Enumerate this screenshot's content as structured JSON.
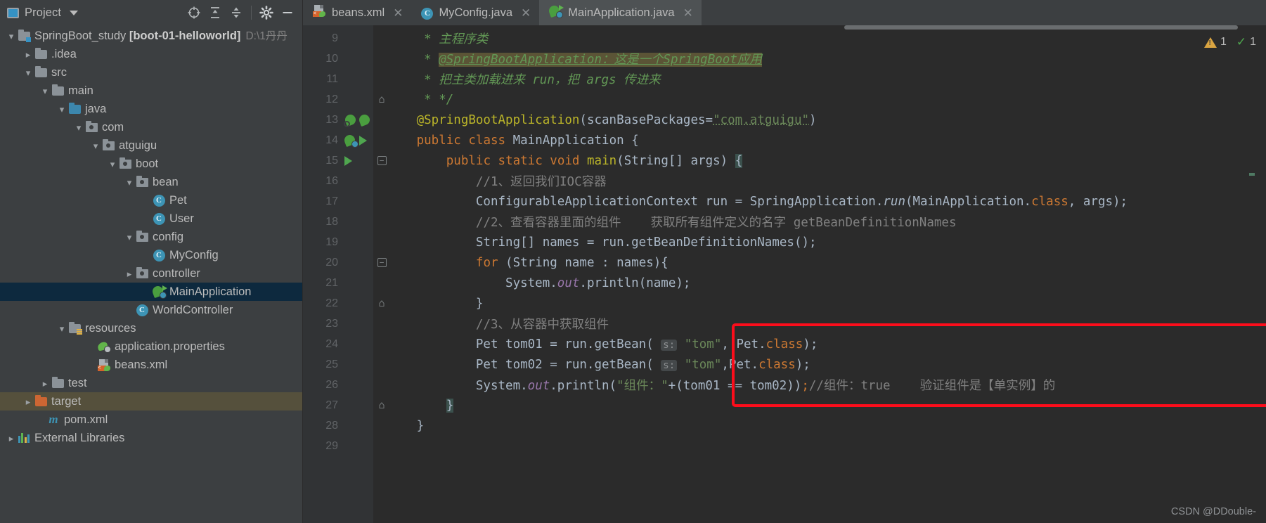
{
  "project_panel": {
    "title": "Project",
    "toolbar_icons": [
      "locate-icon",
      "expand-all-icon",
      "collapse-all-icon",
      "settings-gear-icon",
      "minimize-icon"
    ],
    "tree": [
      {
        "label": "SpringBoot_study",
        "bold_label": "[boot-01-helloworld]",
        "suffix": "D:\\1丹丹",
        "indent": 0,
        "arrow": "down",
        "icon": "module-folder-icon"
      },
      {
        "label": ".idea",
        "indent": 1,
        "arrow": "right",
        "icon": "folder-icon"
      },
      {
        "label": "src",
        "indent": 1,
        "arrow": "down",
        "icon": "folder-icon"
      },
      {
        "label": "main",
        "indent": 2,
        "arrow": "down",
        "icon": "folder-icon"
      },
      {
        "label": "java",
        "indent": 3,
        "arrow": "down",
        "icon": "source-folder-icon"
      },
      {
        "label": "com",
        "indent": 4,
        "arrow": "down",
        "icon": "package-icon"
      },
      {
        "label": "atguigu",
        "indent": 5,
        "arrow": "down",
        "icon": "package-icon"
      },
      {
        "label": "boot",
        "indent": 6,
        "arrow": "down",
        "icon": "package-icon"
      },
      {
        "label": "bean",
        "indent": 7,
        "arrow": "down",
        "icon": "package-icon"
      },
      {
        "label": "Pet",
        "indent": 8,
        "arrow": "none",
        "icon": "class-icon"
      },
      {
        "label": "User",
        "indent": 8,
        "arrow": "none",
        "icon": "class-icon"
      },
      {
        "label": "config",
        "indent": 7,
        "arrow": "down",
        "icon": "package-icon"
      },
      {
        "label": "MyConfig",
        "indent": 8,
        "arrow": "none",
        "icon": "class-icon"
      },
      {
        "label": "controller",
        "indent": 7,
        "arrow": "right",
        "icon": "package-icon"
      },
      {
        "label": "MainApplication",
        "indent": 8,
        "arrow": "none",
        "icon": "spring-class-icon",
        "selected": true
      },
      {
        "label": "WorldController",
        "indent": 8,
        "arrow": "none",
        "icon": "class-icon"
      },
      {
        "label": "resources",
        "indent": 3,
        "arrow": "down",
        "icon": "resources-folder-icon"
      },
      {
        "label": "application.properties",
        "indent": 4,
        "arrow": "none",
        "icon": "spring-properties-icon"
      },
      {
        "label": "beans.xml",
        "indent": 4,
        "arrow": "none",
        "icon": "spring-xml-icon"
      },
      {
        "label": "test",
        "indent": 2,
        "arrow": "right",
        "icon": "folder-icon"
      },
      {
        "label": "target",
        "indent": 1,
        "arrow": "right",
        "icon": "excluded-folder-icon",
        "highlight": true
      },
      {
        "label": "pom.xml",
        "indent": 1,
        "arrow": "none",
        "icon": "maven-icon"
      },
      {
        "label": "External Libraries",
        "indent": 0,
        "arrow": "right",
        "icon": "libraries-icon"
      }
    ]
  },
  "tabs": [
    {
      "label": "beans.xml",
      "icon": "spring-xml-icon",
      "active": false,
      "closable": true
    },
    {
      "label": "MyConfig.java",
      "icon": "class-icon",
      "active": false,
      "closable": true
    },
    {
      "label": "MainApplication.java",
      "icon": "spring-class-icon",
      "active": true,
      "closable": true
    }
  ],
  "inspections": {
    "warning_count": "1",
    "spelling_count": "1"
  },
  "watermark": "CSDN @DDouble-",
  "editor": {
    "first_visible_line": 9,
    "lines": [
      {
        "no": "9",
        "segments": [
          {
            "t": "    * ",
            "c": "c-jdoc"
          },
          {
            "t": "主程序类",
            "c": "c-jdoc"
          }
        ]
      },
      {
        "no": "10",
        "segments": [
          {
            "t": "    * ",
            "c": "c-jdoc"
          },
          {
            "t": "@SpringBootApplication：这是一个SpringBoot应用",
            "c": "c-jdoc-link",
            "hl": true
          }
        ]
      },
      {
        "no": "11",
        "segments": [
          {
            "t": "    * ",
            "c": "c-jdoc"
          },
          {
            "t": "把主类加载进来 run，把 args 传进来",
            "c": "c-jdoc"
          }
        ]
      },
      {
        "no": "12",
        "segments": [
          {
            "t": "    * */",
            "c": "c-jdoc"
          }
        ],
        "fold": "end"
      },
      {
        "no": "13",
        "segments": [
          {
            "t": "   ",
            "c": "c-txt"
          },
          {
            "t": "@SpringBootApplication",
            "c": "c-ann"
          },
          {
            "t": "(scanBasePackages=",
            "c": "c-txt"
          },
          {
            "t": "\"com.atguigu\"",
            "c": "c-str",
            "underline": true
          },
          {
            "t": ")",
            "c": "c-txt"
          }
        ],
        "gutter": [
          "bean-icon",
          "check-icon"
        ]
      },
      {
        "no": "14",
        "segments": [
          {
            "t": "   ",
            "c": "c-txt"
          },
          {
            "t": "public",
            "c": "c-kw"
          },
          {
            "t": " ",
            "c": "c-txt"
          },
          {
            "t": "class",
            "c": "c-kw"
          },
          {
            "t": " MainApplication {",
            "c": "c-txt"
          }
        ],
        "gutter": [
          "spring-bean-icon",
          "run-icon"
        ]
      },
      {
        "no": "15",
        "segments": [
          {
            "t": "       ",
            "c": "c-txt"
          },
          {
            "t": "public",
            "c": "c-kw"
          },
          {
            "t": " ",
            "c": "c-txt"
          },
          {
            "t": "static",
            "c": "c-kw"
          },
          {
            "t": " ",
            "c": "c-txt"
          },
          {
            "t": "void",
            "c": "c-kw"
          },
          {
            "t": " ",
            "c": "c-txt"
          },
          {
            "t": "main",
            "c": "c-ann"
          },
          {
            "t": "(String[] args) ",
            "c": "c-txt"
          },
          {
            "t": "{",
            "c": "c-brace-hl"
          }
        ],
        "gutter": [
          "run-icon"
        ],
        "fold": "start"
      },
      {
        "no": "16",
        "segments": [
          {
            "t": "           ",
            "c": "c-txt"
          },
          {
            "t": "//1、返回我们IOC容器",
            "c": "c-cmt"
          }
        ]
      },
      {
        "no": "17",
        "segments": [
          {
            "t": "           ConfigurableApplicationContext run = SpringApplication.",
            "c": "c-txt"
          },
          {
            "t": "run",
            "c": "c-method"
          },
          {
            "t": "(MainApplication.",
            "c": "c-txt"
          },
          {
            "t": "class",
            "c": "c-kw"
          },
          {
            "t": ", args);",
            "c": "c-txt"
          }
        ]
      },
      {
        "no": "18",
        "segments": [
          {
            "t": "           ",
            "c": "c-txt"
          },
          {
            "t": "//2、查看容器里面的组件    获取所有组件定义的名字 getBeanDefinitionNames",
            "c": "c-cmt"
          }
        ]
      },
      {
        "no": "19",
        "segments": [
          {
            "t": "           String[] names = run.getBeanDefinitionNames();",
            "c": "c-txt"
          }
        ]
      },
      {
        "no": "20",
        "segments": [
          {
            "t": "           ",
            "c": "c-txt"
          },
          {
            "t": "for",
            "c": "c-kw"
          },
          {
            "t": " (String name : names){",
            "c": "c-txt"
          }
        ],
        "fold": "start"
      },
      {
        "no": "21",
        "segments": [
          {
            "t": "               System.",
            "c": "c-txt"
          },
          {
            "t": "out",
            "c": "c-static"
          },
          {
            "t": ".println(name);",
            "c": "c-txt"
          }
        ]
      },
      {
        "no": "22",
        "segments": [
          {
            "t": "           }",
            "c": "c-txt"
          }
        ],
        "fold": "end"
      },
      {
        "no": "23",
        "segments": [
          {
            "t": "           ",
            "c": "c-txt"
          },
          {
            "t": "//3、从容器中获取组件",
            "c": "c-cmt"
          }
        ]
      },
      {
        "no": "24",
        "segments": [
          {
            "t": "           Pet tom01 = run.getBean( ",
            "c": "c-txt"
          },
          {
            "t": "s:",
            "c": "hint"
          },
          {
            "t": " ",
            "c": "c-txt"
          },
          {
            "t": "\"tom\"",
            "c": "c-str"
          },
          {
            "t": ", Pet.",
            "c": "c-txt"
          },
          {
            "t": "class",
            "c": "c-kw"
          },
          {
            "t": ");",
            "c": "c-txt"
          }
        ]
      },
      {
        "no": "25",
        "segments": [
          {
            "t": "           Pet tom02 = run.getBean( ",
            "c": "c-txt"
          },
          {
            "t": "s:",
            "c": "hint"
          },
          {
            "t": " ",
            "c": "c-txt"
          },
          {
            "t": "\"tom\"",
            "c": "c-str"
          },
          {
            "t": ",Pet.",
            "c": "c-txt"
          },
          {
            "t": "class",
            "c": "c-kw"
          },
          {
            "t": ");",
            "c": "c-txt"
          }
        ]
      },
      {
        "no": "26",
        "segments": [
          {
            "t": "           System.",
            "c": "c-txt"
          },
          {
            "t": "out",
            "c": "c-static"
          },
          {
            "t": ".println(",
            "c": "c-txt"
          },
          {
            "t": "\"组件：\"",
            "c": "c-str"
          },
          {
            "t": "+(tom01 == tom02))",
            "c": "c-txt"
          },
          {
            "t": ";",
            "c": "c-semi"
          },
          {
            "t": "//组件：true    验证组件是【单实例】的",
            "c": "c-cmt"
          }
        ]
      },
      {
        "no": "27",
        "segments": [
          {
            "t": "       ",
            "c": "c-txt"
          },
          {
            "t": "}",
            "c": "c-brace-hl"
          }
        ],
        "fold": "end"
      },
      {
        "no": "28",
        "segments": [
          {
            "t": "   }",
            "c": "c-txt"
          }
        ]
      },
      {
        "no": "29",
        "segments": [
          {
            "t": "",
            "c": "c-txt"
          }
        ]
      }
    ]
  },
  "colors": {
    "panel_bg": "#3c3f41",
    "editor_bg": "#2b2b2b",
    "gutter_bg": "#313335",
    "selection_blue": "#0d293e",
    "target_highlight": "#55503c",
    "red_box": "#fc0d1b",
    "keyword_orange": "#cc7832",
    "string_green": "#6a8759",
    "annotation_yellow": "#bbb529",
    "comment_grey": "#808080",
    "javadoc_green": "#629755",
    "text_default": "#a9b7c6"
  }
}
